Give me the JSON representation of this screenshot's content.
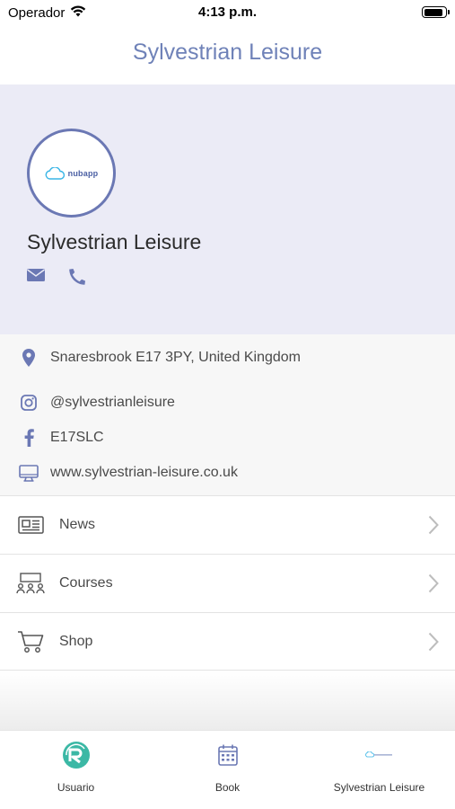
{
  "status_bar": {
    "carrier": "Operador",
    "time": "4:13 p.m.",
    "battery_level": 0.9
  },
  "nav": {
    "title": "Sylvestrian Leisure"
  },
  "profile": {
    "logo_text": "nubapp",
    "name": "Sylvestrian Leisure",
    "contact_icons": [
      "envelope-icon",
      "phone-icon"
    ]
  },
  "info": {
    "address": "Snaresbrook E17 3PY, United Kingdom",
    "instagram": "@sylvestrianleisure",
    "facebook": "E17SLC",
    "website": "www.sylvestrian-leisure.co.uk"
  },
  "menu": {
    "items": [
      {
        "label": "News",
        "icon": "newspaper-icon"
      },
      {
        "label": "Courses",
        "icon": "classroom-icon"
      },
      {
        "label": "Shop",
        "icon": "cart-icon"
      }
    ]
  },
  "tabs": [
    {
      "label": "Usuario",
      "icon": "user-logo-icon",
      "active": true
    },
    {
      "label": "Book",
      "icon": "calendar-icon"
    },
    {
      "label": "Sylvestrian Leisure",
      "icon": "center-logo-icon"
    }
  ],
  "colors": {
    "accent": "#6f82b8",
    "header_bg": "#ebebf6",
    "active_tab": "#3bb8a5"
  }
}
